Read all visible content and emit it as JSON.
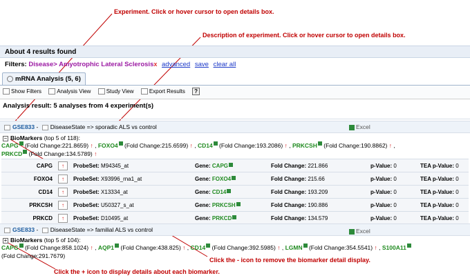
{
  "annotations": {
    "experiment": "Experiment. Click or hover cursor to open details box.",
    "description": "Description of experiment. Click or hover cursor to open details box.",
    "minus_icon": "Click the - icon to remove the biomarker detail display.",
    "plus_icon": "Click the + icon to display details about each biomarker."
  },
  "results_header": "About 4 results found",
  "filters": {
    "label": "Filters:",
    "value": "Disease> Amyotrophic Lateral Sclerosis",
    "remove_icon": "x",
    "advanced": "advanced",
    "save": "save",
    "clear_all": "clear all"
  },
  "tab": {
    "label": "mRNA Analysis (5, 6)"
  },
  "toolbar": {
    "show_filters": "Show Filters",
    "analysis_view": "Analysis View",
    "study_view": "Study View",
    "export_results": "Export Results",
    "help": "?"
  },
  "analysis_result": "Analysis result:  5 analyses  from 4 experiment(s)",
  "experiments": [
    {
      "id": "GSE833",
      "sep": " - ",
      "description": "DiseaseState => sporadic ALS vs control",
      "excel": "Excel",
      "biomarkers_title": "BioMarkers",
      "biomarkers_count": "(top 5 of 118):",
      "inline": [
        {
          "gene": "CAPG",
          "fc": "(Fold Change:221.8659)"
        },
        {
          "gene": "FOXO4",
          "fc": "(Fold Change:215.6599)"
        },
        {
          "gene": "CD14",
          "fc": "(Fold Change:193.2086)"
        },
        {
          "gene": "PRKCSH",
          "fc": "(Fold Change:190.8862)"
        },
        {
          "gene": "PRKCD",
          "fc": "(Fold Change:134.5789)"
        }
      ],
      "rows": [
        {
          "gene": "CAPG",
          "probeset": "M94345_at",
          "fold_change": "221.866",
          "p_value": "0",
          "tea_p_value": "0"
        },
        {
          "gene": "FOXO4",
          "probeset": "X93996_rna1_at",
          "fold_change": "215.66",
          "p_value": "0",
          "tea_p_value": "0"
        },
        {
          "gene": "CD14",
          "probeset": "X13334_at",
          "fold_change": "193.209",
          "p_value": "0",
          "tea_p_value": "0"
        },
        {
          "gene": "PRKCSH",
          "probeset": "U50327_s_at",
          "fold_change": "190.886",
          "p_value": "0",
          "tea_p_value": "0"
        },
        {
          "gene": "PRKCD",
          "probeset": "D10495_at",
          "fold_change": "134.579",
          "p_value": "0",
          "tea_p_value": "0"
        }
      ]
    },
    {
      "id": "GSE833",
      "sep": " - ",
      "description": "DiseaseState => familial ALS vs control",
      "excel": "Excel",
      "biomarkers_title": "BioMarkers",
      "biomarkers_count": "(top 5 of 104):",
      "inline": [
        {
          "gene": "CAPG",
          "fc": "(Fold Change:858.1024)"
        },
        {
          "gene": "AQP1",
          "fc": "(Fold Change:438.825)"
        },
        {
          "gene": "CD14",
          "fc": "(Fold Change:392.5985)"
        },
        {
          "gene": "LGMN",
          "fc": "(Fold Change:354.5541)"
        },
        {
          "gene": "S100A11",
          "fc": "(Fold Change:291.7679)"
        }
      ]
    }
  ],
  "labels": {
    "probeset": "ProbeSet:",
    "gene": "Gene:",
    "fold_change": "Fold Change:",
    "p_value": "p-Value:",
    "tea_p_value": "TEA p-Value:",
    "up_arrow": "↑",
    "comma": ","
  },
  "colors": {
    "annotation": "#c00000",
    "gene": "#1f8a1f",
    "filter": "#9b1aa3",
    "link": "#1a37c8",
    "up": "#d01010"
  }
}
